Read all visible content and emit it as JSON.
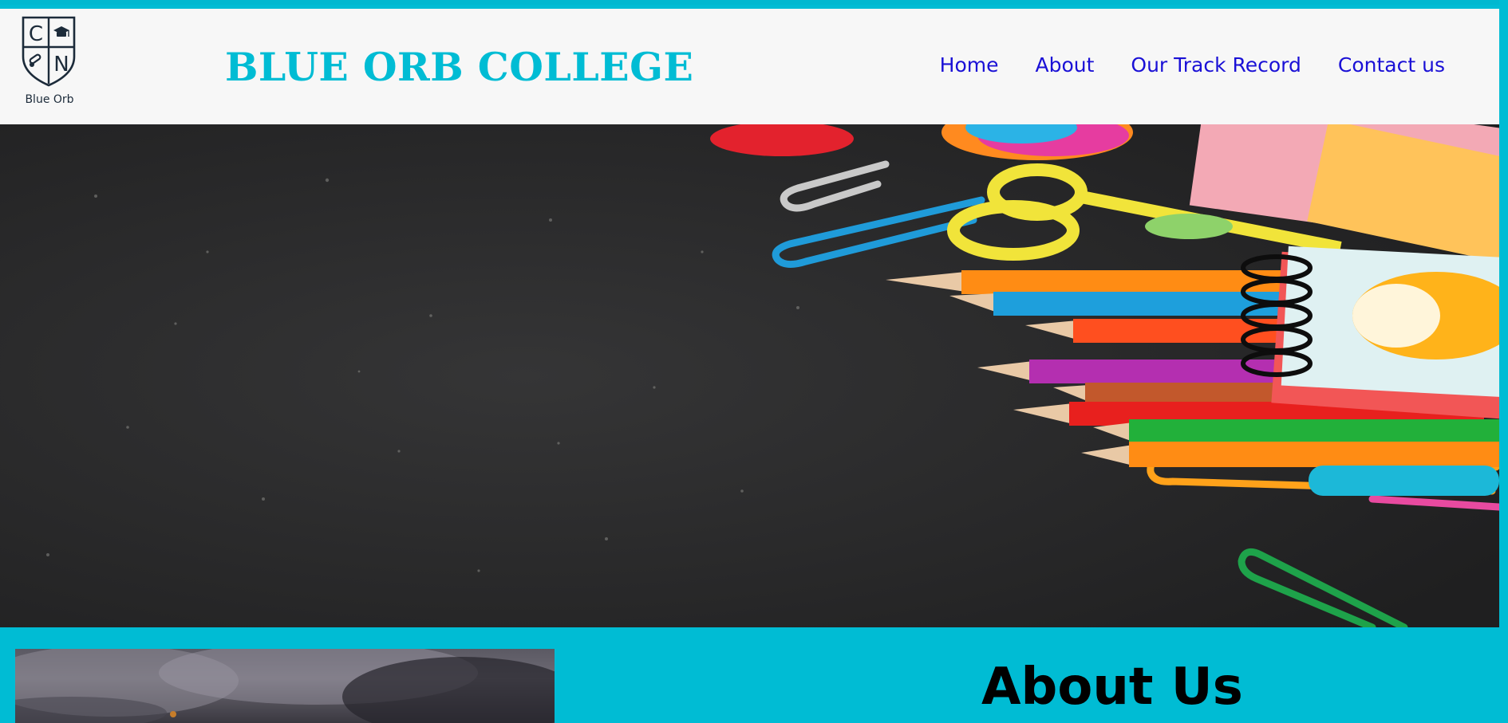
{
  "header": {
    "logo": {
      "letters": [
        "C",
        "N"
      ],
      "caption": "Blue Orb"
    },
    "brand_title": "BLUE ORB COLLEGE"
  },
  "nav": {
    "items": [
      {
        "label": "Home"
      },
      {
        "label": "About"
      },
      {
        "label": "Our Track Record"
      },
      {
        "label": "Contact us"
      }
    ]
  },
  "hero": {
    "image": "school-supplies-on-chalkboard"
  },
  "about": {
    "title": "About Us",
    "image": "misty-grey-sky-photo"
  },
  "colors": {
    "accent": "#00bcd4",
    "nav_link": "#1a10d6",
    "header_bg": "#f7f7f7",
    "logo_ink": "#1c2b3a"
  }
}
